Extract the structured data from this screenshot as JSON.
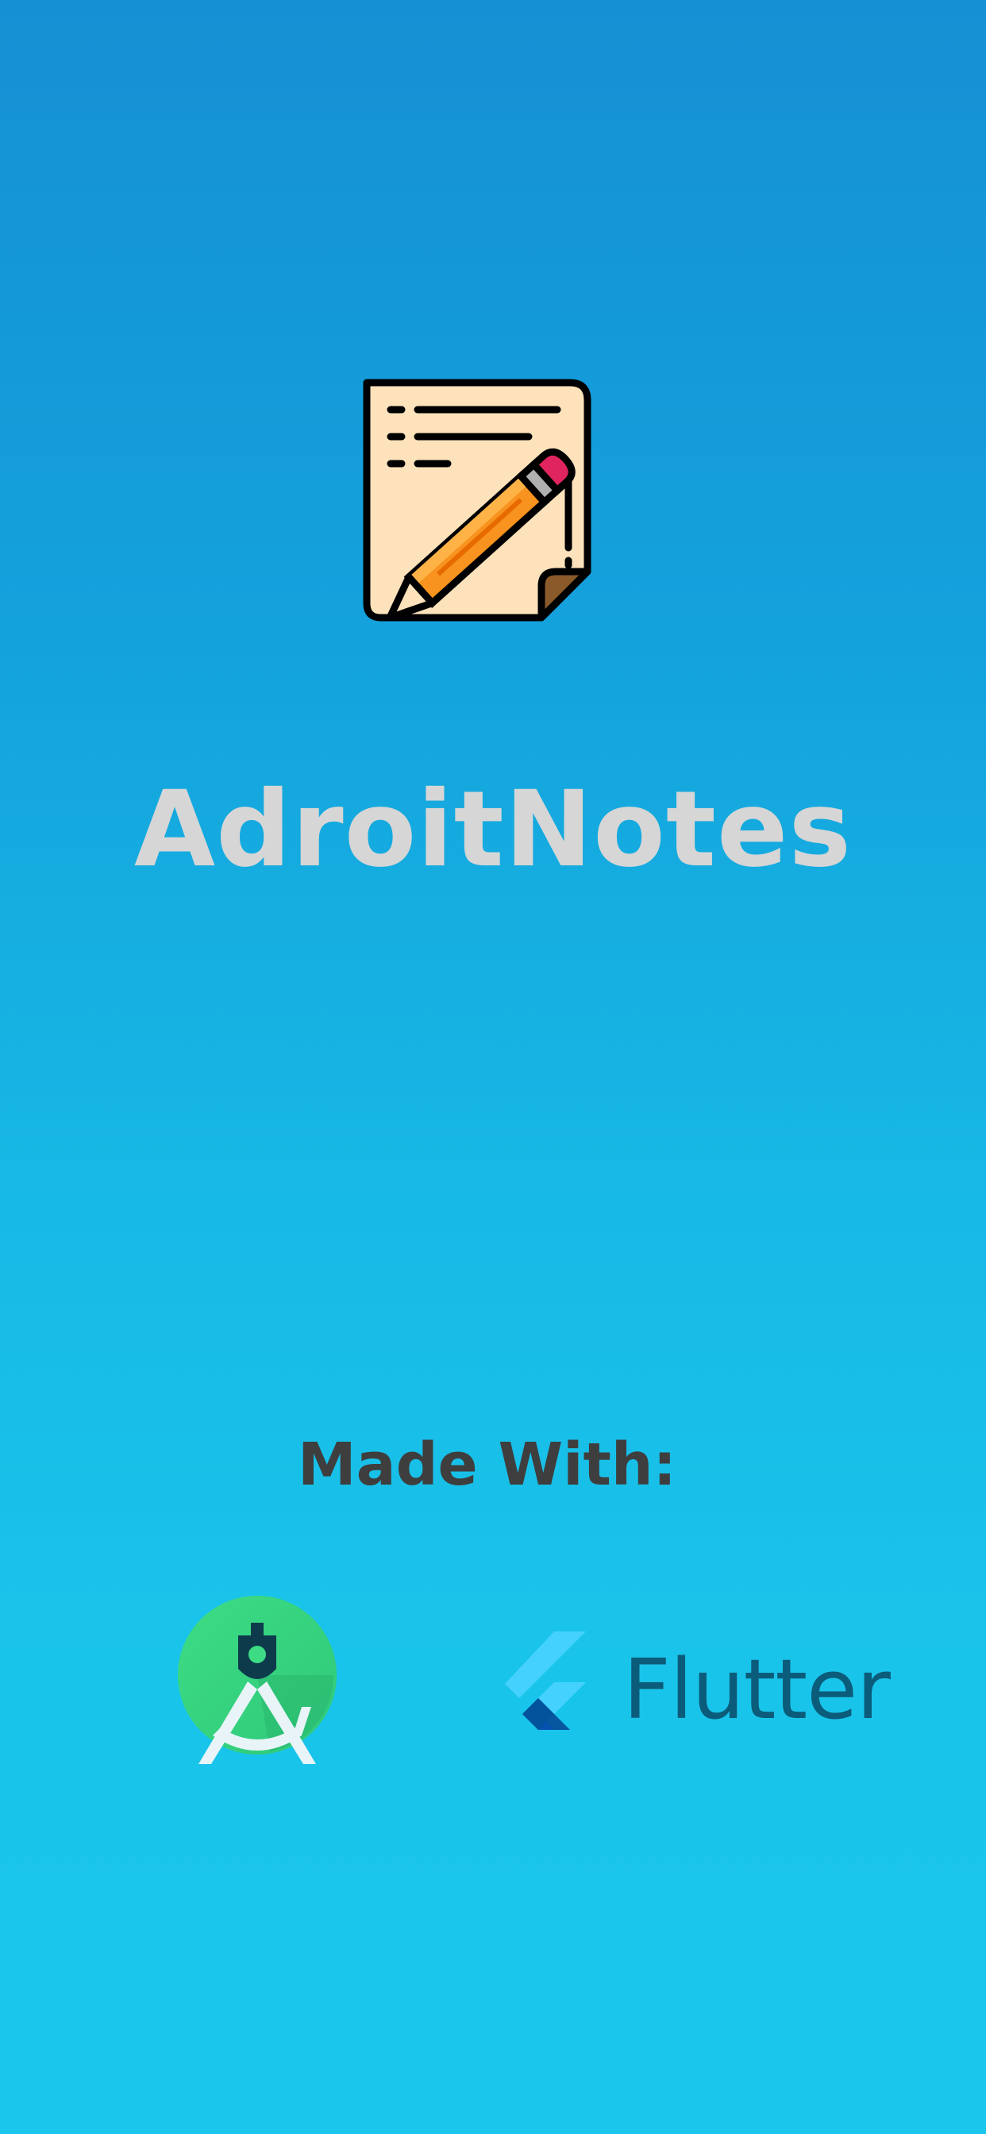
{
  "splash": {
    "app_name": "AdroitNotes",
    "made_with_label": "Made With:",
    "tools": {
      "android_studio": {
        "icon": "android-studio-icon"
      },
      "flutter": {
        "icon": "flutter-icon",
        "wordmark": "Flutter"
      }
    },
    "app_icon": "notepad-pencil-icon"
  },
  "colors": {
    "background_top": "#1590d4",
    "background_bottom": "#1ac6ec",
    "title_text": "#d6d6d6",
    "made_with_text": "#3e3e3e",
    "flutter_text": "#0b5c7a"
  }
}
